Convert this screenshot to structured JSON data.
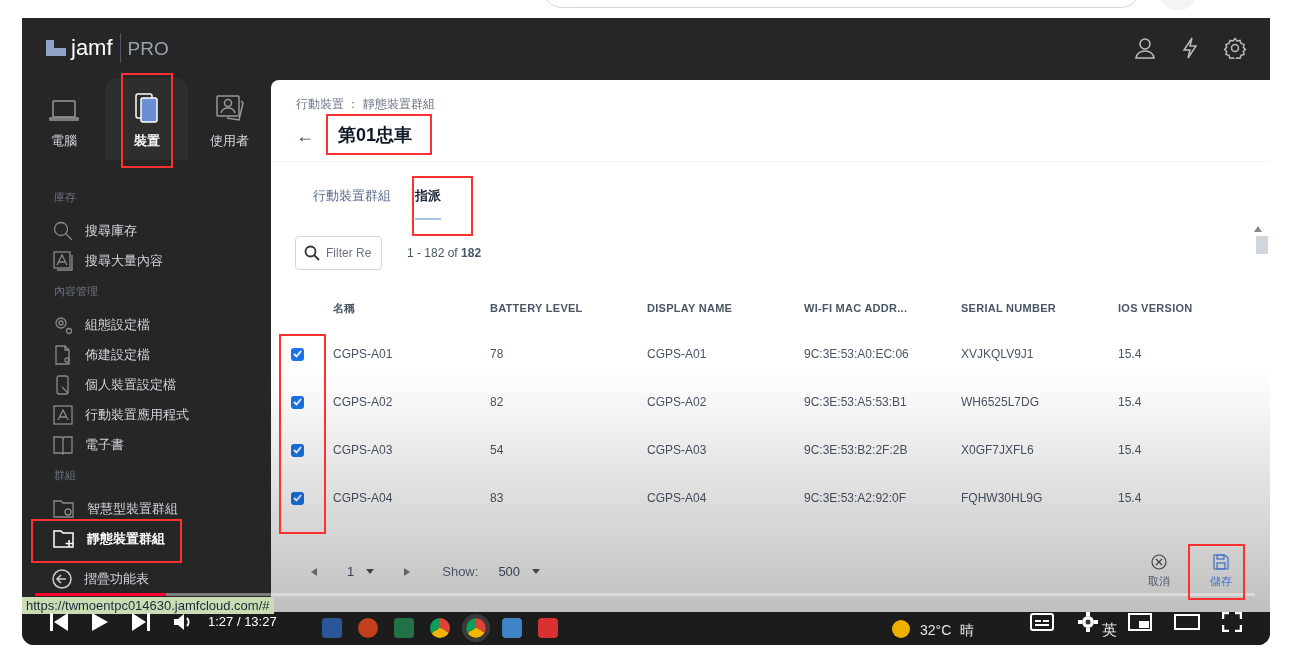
{
  "app": {
    "logo": "jamf",
    "product": "PRO"
  },
  "sidebar": {
    "tabs": [
      {
        "label": "電腦",
        "kind": "laptop",
        "selected": false
      },
      {
        "label": "裝置",
        "kind": "device",
        "selected": true
      },
      {
        "label": "使用者",
        "kind": "user",
        "selected": false
      }
    ],
    "sections": [
      {
        "heading": "庫存",
        "items": [
          {
            "label": "搜尋庫存",
            "kind": "search",
            "selected": false
          },
          {
            "label": "搜尋大量內容",
            "kind": "image",
            "selected": false
          }
        ]
      },
      {
        "heading": "內容管理",
        "items": [
          {
            "label": "組態設定檔",
            "kind": "gear",
            "selected": false
          },
          {
            "label": "佈建設定檔",
            "kind": "file",
            "selected": false
          },
          {
            "label": "個人裝置設定檔",
            "kind": "phone",
            "selected": false
          },
          {
            "label": "行動裝置應用程式",
            "kind": "app",
            "selected": false
          },
          {
            "label": "電子書",
            "kind": "book",
            "selected": false
          }
        ]
      },
      {
        "heading": "群組",
        "items": [
          {
            "label": "智慧型裝置群組",
            "kind": "smartfolder",
            "selected": false
          },
          {
            "label": "靜態裝置群組",
            "kind": "folderplus",
            "selected": true
          }
        ]
      }
    ],
    "collapse": "摺疊功能表"
  },
  "content": {
    "breadcrumb": "行動裝置 ： 靜態裝置群組",
    "back": "←",
    "title": "第01忠車",
    "tabs": [
      {
        "label": "行動裝置群組",
        "selected": false
      },
      {
        "label": "指派",
        "selected": true
      }
    ],
    "filter": {
      "placeholder": "Filter Re"
    },
    "count": "1 - 182 of **182**",
    "columns": [
      "名稱",
      "BATTERY LEVEL",
      "DISPLAY NAME",
      "WI-FI MAC ADDR...",
      "SERIAL NUMBER",
      "IOS VERSION"
    ],
    "rows": [
      {
        "checked": true,
        "cells": [
          "CGPS-A01",
          "78",
          "CGPS-A01",
          "9C:3E:53:A0:EC:06",
          "XVJKQLV9J1",
          "15.4"
        ]
      },
      {
        "checked": true,
        "cells": [
          "CGPS-A02",
          "82",
          "CGPS-A02",
          "9C:3E:53:A5:53:B1",
          "WH6525L7DG",
          "15.4"
        ]
      },
      {
        "checked": true,
        "cells": [
          "CGPS-A03",
          "54",
          "CGPS-A03",
          "9C:3E:53:B2:2F:2B",
          "X0GF7JXFL6",
          "15.4"
        ]
      },
      {
        "checked": true,
        "cells": [
          "CGPS-A04",
          "83",
          "CGPS-A04",
          "9C:3E:53:A2:92:0F",
          "FQHW30HL9G",
          "15.4"
        ]
      }
    ],
    "pager": {
      "page": "1",
      "show_label": "Show:",
      "show_value": "500"
    },
    "actions": [
      {
        "label": "取消",
        "kind": "cancel"
      },
      {
        "label": "儲存",
        "kind": "save"
      }
    ]
  },
  "taskbar": {
    "temperature": "32°C",
    "weather": "晴",
    "ime": "英"
  },
  "player": {
    "url": "https://twmoentpc014630.jamfcloud.com/#",
    "time": "1:27 / 13:27",
    "level": 0.107
  }
}
